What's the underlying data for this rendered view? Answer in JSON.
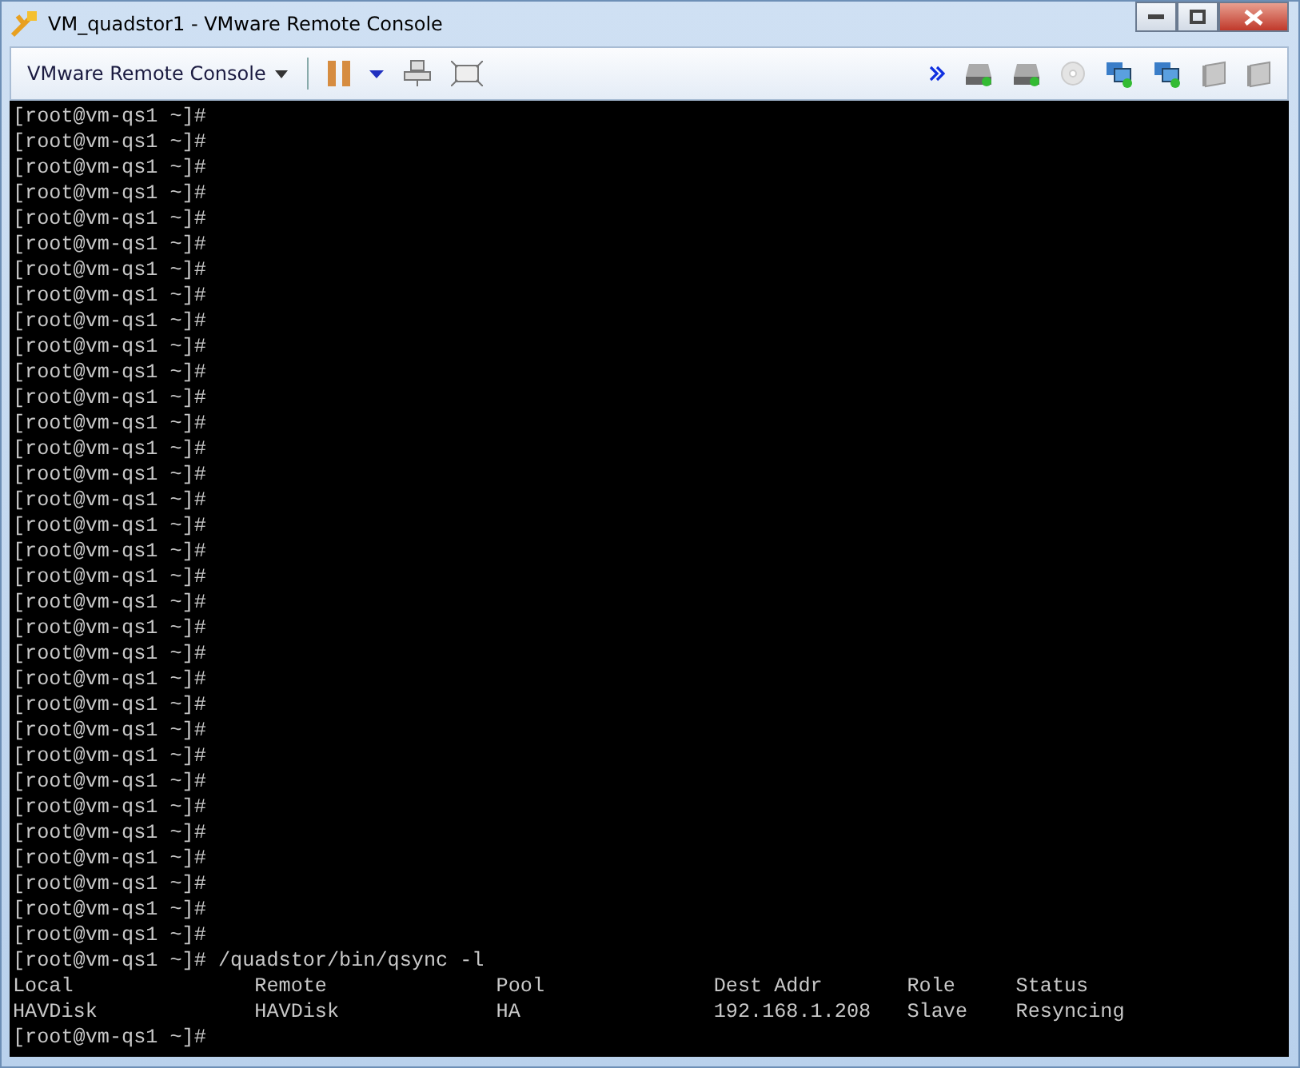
{
  "window": {
    "title": "VM_quadstor1 - VMware Remote Console"
  },
  "toolbar": {
    "menu_label": "VMware Remote Console",
    "paused": true
  },
  "terminal": {
    "lines": [
      "[root@vm-qs1 ~]#",
      "[root@vm-qs1 ~]#",
      "[root@vm-qs1 ~]#",
      "[root@vm-qs1 ~]#",
      "[root@vm-qs1 ~]#",
      "[root@vm-qs1 ~]#",
      "[root@vm-qs1 ~]#",
      "[root@vm-qs1 ~]#",
      "[root@vm-qs1 ~]#",
      "[root@vm-qs1 ~]#",
      "[root@vm-qs1 ~]#",
      "[root@vm-qs1 ~]#",
      "[root@vm-qs1 ~]#",
      "[root@vm-qs1 ~]#",
      "[root@vm-qs1 ~]#",
      "[root@vm-qs1 ~]#",
      "[root@vm-qs1 ~]#",
      "[root@vm-qs1 ~]#",
      "[root@vm-qs1 ~]#",
      "[root@vm-qs1 ~]#",
      "[root@vm-qs1 ~]#",
      "[root@vm-qs1 ~]#",
      "[root@vm-qs1 ~]#",
      "[root@vm-qs1 ~]#",
      "[root@vm-qs1 ~]#",
      "[root@vm-qs1 ~]#",
      "[root@vm-qs1 ~]#",
      "[root@vm-qs1 ~]#",
      "[root@vm-qs1 ~]#",
      "[root@vm-qs1 ~]#",
      "[root@vm-qs1 ~]#",
      "[root@vm-qs1 ~]#",
      "[root@vm-qs1 ~]#",
      "[root@vm-qs1 ~]# /quadstor/bin/qsync -l",
      "Local               Remote              Pool              Dest Addr       Role     Status",
      "HAVDisk             HAVDisk             HA                192.168.1.208   Slave    Resyncing",
      "[root@vm-qs1 ~]#"
    ]
  }
}
